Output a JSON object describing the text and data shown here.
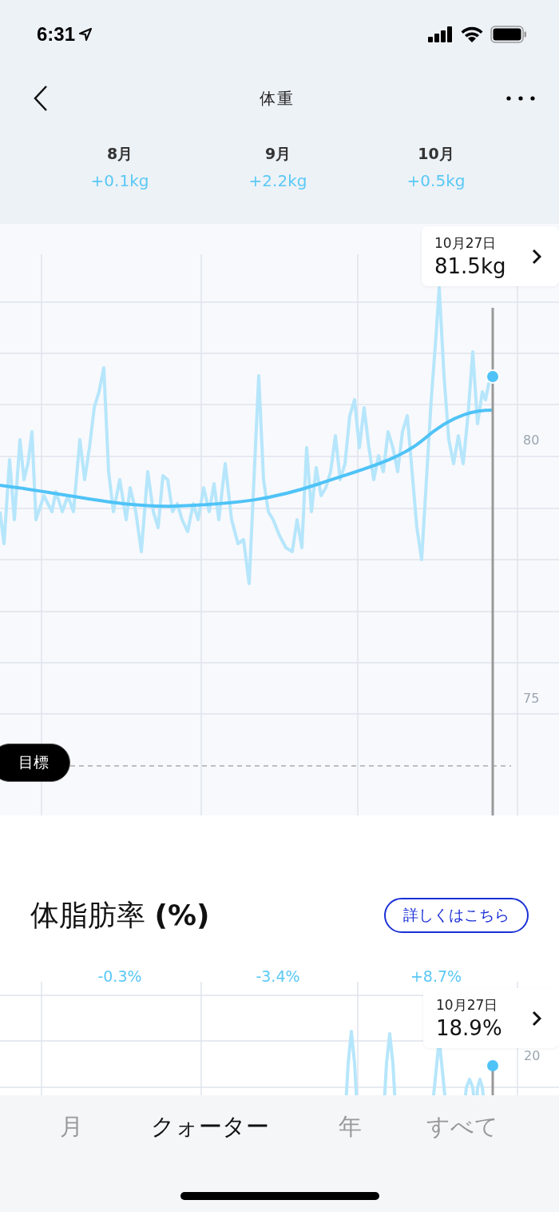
{
  "status_bar": {
    "time": "6:31"
  },
  "nav": {
    "title": "体重"
  },
  "month_summary": [
    {
      "month": "8月",
      "change": "+0.1kg"
    },
    {
      "month": "9月",
      "change": "+2.2kg"
    },
    {
      "month": "10月",
      "change": "+0.5kg"
    }
  ],
  "weight_chart": {
    "y_labels": [
      "80",
      "75"
    ],
    "goal_label": "目標",
    "tooltip": {
      "date": "10月27日",
      "value": "81.5kg"
    }
  },
  "body_fat": {
    "title": "体脂肪率 **(%)**",
    "details_button": "詳しくはこちら",
    "changes": [
      "-0.3%",
      "-3.4%",
      "+8.7%"
    ],
    "y_labels": [
      "20"
    ],
    "tooltip": {
      "date": "10月27日",
      "value": "18.9%"
    }
  },
  "tabs": [
    {
      "label": "月",
      "selected": false
    },
    {
      "label": "クォーター",
      "selected": true
    },
    {
      "label": "年",
      "selected": false
    },
    {
      "label": "すべて",
      "selected": false
    }
  ]
}
